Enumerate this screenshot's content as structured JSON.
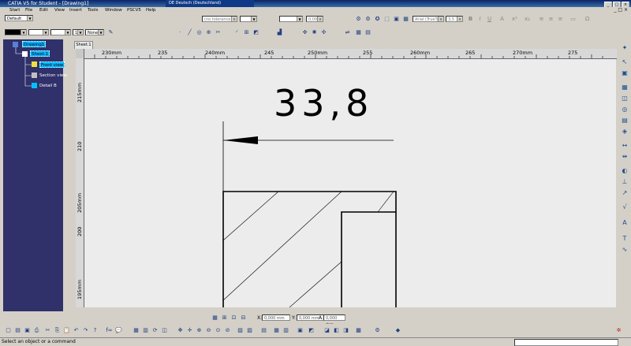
{
  "window": {
    "title": "CATIA V5 for Student - [Drawing1]",
    "ime_label": "DE Deutsch (Deutschland)"
  },
  "menu": [
    "Start",
    "File",
    "Edit",
    "View",
    "Insert",
    "Tools",
    "Window",
    "PSCV5",
    "Help"
  ],
  "toolbar": {
    "style_select": "Default",
    "tolerance_select": "(no tolerance)",
    "value_field": "0,000",
    "font_select": "Arial (TrueTyp",
    "font_size": "3,5",
    "fill_select": "None",
    "line_weight_select": "1"
  },
  "tree": {
    "items": [
      {
        "label": "Drawing1",
        "selected": true
      },
      {
        "label": "Sheet.1",
        "selected": true
      },
      {
        "label": "Front view",
        "selected": true
      },
      {
        "label": "Section view",
        "selected": false
      },
      {
        "label": "Detail B",
        "selected": false
      }
    ]
  },
  "sheet_tab": "Sheet.1",
  "ruler": {
    "top": [
      "230mm",
      "235",
      "240mm",
      "245",
      "250mm",
      "255",
      "260mm",
      "265",
      "270mm",
      "275"
    ],
    "left": [
      "215mm",
      "210",
      "205mm",
      "200",
      "195mm"
    ]
  },
  "drawing": {
    "dimension_text": "33,8"
  },
  "coords": {
    "x_label": "X:",
    "x_value": "0,000 mm",
    "y_label": "Y:",
    "y_value": "0,000 mm",
    "a_label": "A:",
    "a_value": "0,000 deg"
  },
  "status": {
    "message": "Select an object or a command"
  }
}
